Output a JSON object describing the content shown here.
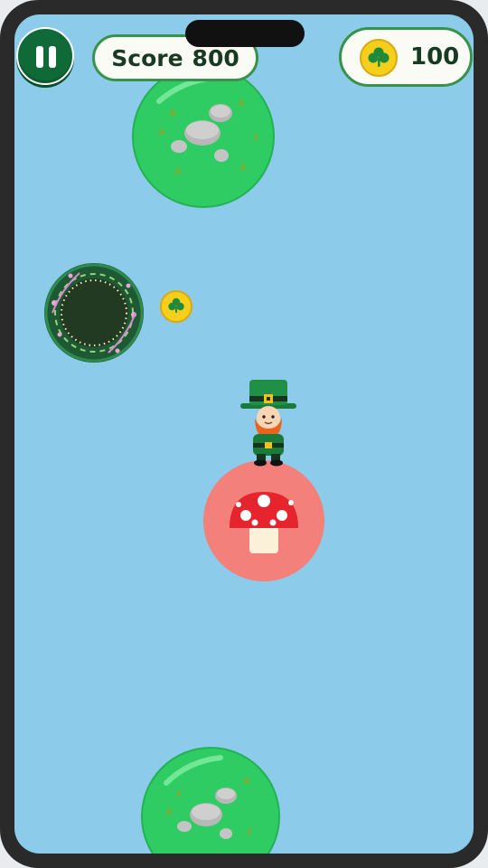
{
  "hud": {
    "score_label": "Score",
    "score_value": "800",
    "coins_value": "100"
  },
  "icons": {
    "pause": "pause-icon",
    "coin": "shamrock-coin-icon",
    "character": "leprechaun-icon",
    "mushroom": "mushroom-icon",
    "portal": "portal-icon"
  },
  "colors": {
    "sky": "#8ccbea",
    "hud_green": "#0f6a37",
    "grass_planet": "#2fcc63",
    "mushroom_bubble": "#f3807a",
    "coin": "#f6cf1c"
  }
}
